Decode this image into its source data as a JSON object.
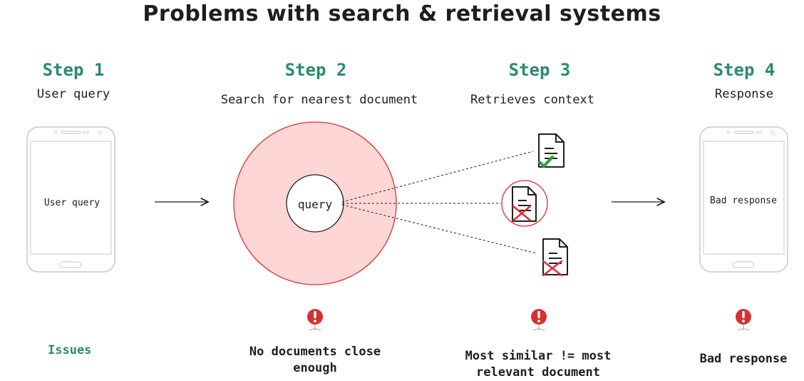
{
  "title": "Problems with search & retrieval systems",
  "steps": [
    {
      "label": "Step 1",
      "subtitle": "User query"
    },
    {
      "label": "Step 2",
      "subtitle": "Search for nearest document"
    },
    {
      "label": "Step 3",
      "subtitle": "Retrieves context"
    },
    {
      "label": "Step 4",
      "subtitle": "Response"
    }
  ],
  "phone_left_text": "User query",
  "query_label": "query",
  "phone_right_text": "Bad response",
  "issues_label": "Issues",
  "issues": [
    "No documents close enough",
    "Most similar != most relevant document",
    "Bad response"
  ],
  "colors": {
    "accent": "#2b8a6e",
    "circle_fill": "#ffd6d6",
    "circle_stroke": "#e03131",
    "check": "#2f9e44",
    "cross": "#e03131"
  },
  "icons": [
    "smartphone-icon",
    "document-check-icon",
    "document-cross-icon",
    "alert-icon",
    "arrow-icon"
  ]
}
